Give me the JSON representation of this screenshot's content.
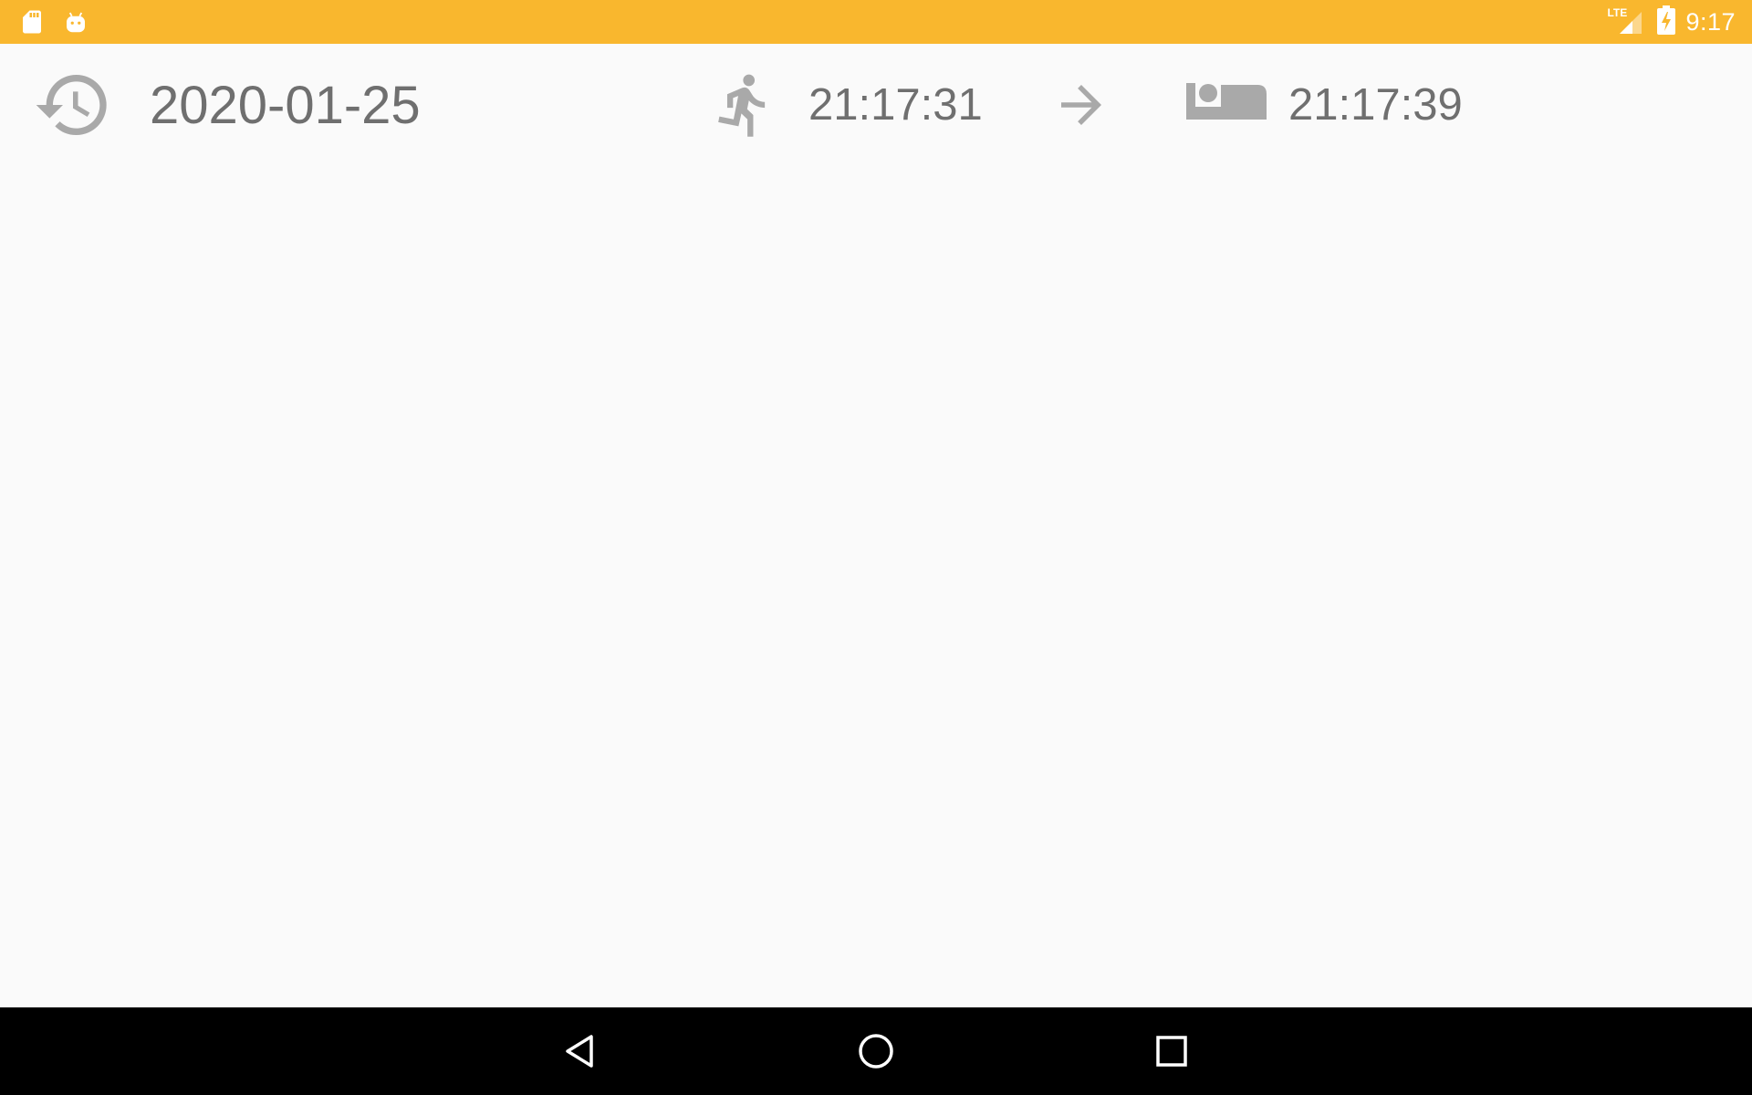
{
  "status_bar": {
    "background_color": "#f9b72e",
    "left_icons": [
      "sd-card-icon",
      "android-debug-icon"
    ],
    "network_label": "LTE",
    "time": "9:17",
    "icons": [
      "lte-signal-icon",
      "battery-charging-icon"
    ]
  },
  "record": {
    "date": "2020-01-25",
    "start_time": "21:17:31",
    "end_time": "21:17:39",
    "icons": {
      "date": "history-icon",
      "start": "running-person-icon",
      "arrow": "arrow-right-icon",
      "end": "bed-icon"
    },
    "text_color": "#6f6f6f",
    "icon_color": "#a9a9a9"
  },
  "nav_bar": {
    "buttons": [
      "back-button",
      "home-button",
      "recents-button"
    ]
  }
}
